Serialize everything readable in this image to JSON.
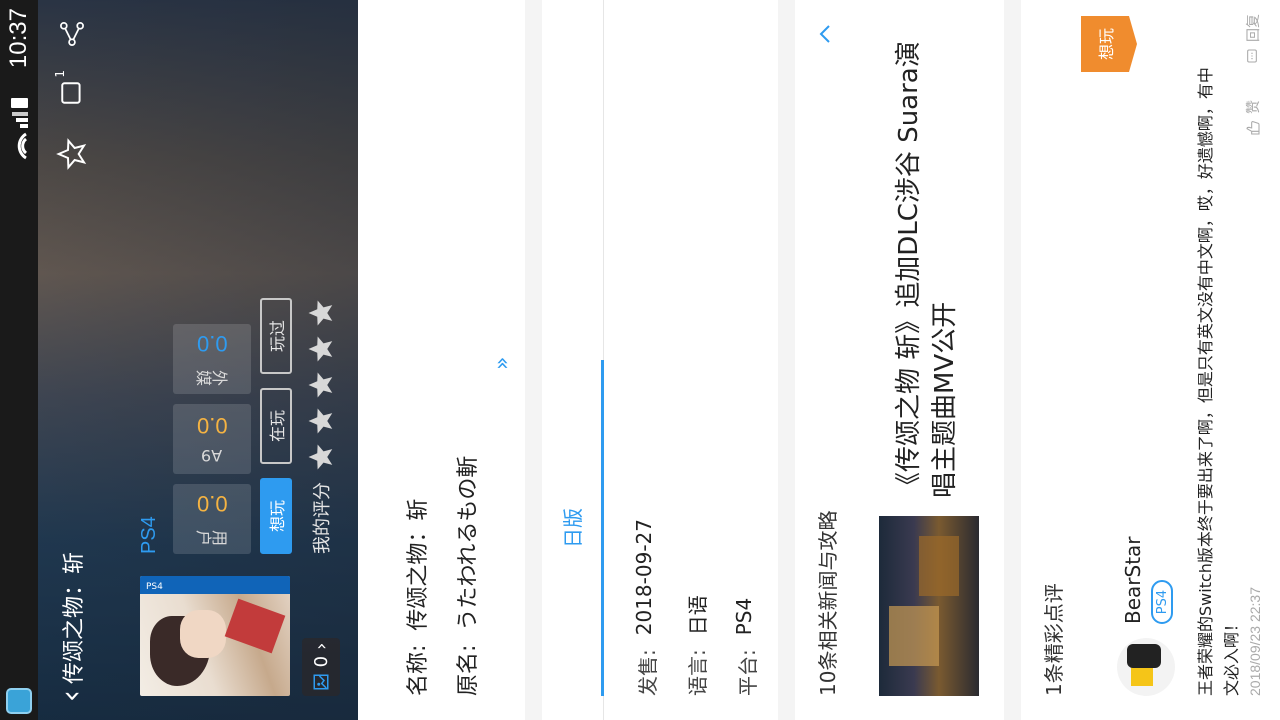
{
  "status_bar": {
    "time": "10:37"
  },
  "header": {
    "title": "传颂之物：斩",
    "share_count": "1",
    "image_count": "0",
    "platform": "PS4",
    "scores": [
      {
        "label": "用户",
        "value": "0.0"
      },
      {
        "label": "A9",
        "value": "0.0"
      },
      {
        "label": "外媒",
        "value": "0.0"
      }
    ],
    "status_buttons": [
      "想玩",
      "在玩",
      "玩过"
    ],
    "my_rating_label": "我的评分",
    "stars": 5,
    "cover_text": "PS4"
  },
  "info": {
    "name_label": "名称:",
    "name_value": "传颂之物：斩",
    "original_label": "原名:",
    "original_value": "うたわれるもの斬"
  },
  "version": {
    "tab_label": "日版",
    "release_label": "发售:",
    "release_value": "2018-09-27",
    "language_label": "语言:",
    "language_value": "日语",
    "platform_label": "平台:",
    "platform_value": "PS4"
  },
  "news": {
    "section_title": "10条相关新闻与攻略",
    "item_title": "《传颂之物 斩》追加DLC涉谷 Suara演唱主题曲MV公开"
  },
  "reviews": {
    "section_title": "1条精彩点评",
    "user": "BearStar",
    "platform_tag": "PS4",
    "badge": "想玩",
    "body": "王者荣耀的Switch版本终于要出来了啊，但是只有英文没有中文啊，哎，好遗憾啊，有中文必入啊！",
    "time": "2018/09/23 22:37",
    "like_label": "赞",
    "reply_label": "回复"
  },
  "colors": {
    "accent": "#2e9bf0",
    "score_yellow": "#f5b342",
    "badge_orange": "#f08c2e"
  }
}
